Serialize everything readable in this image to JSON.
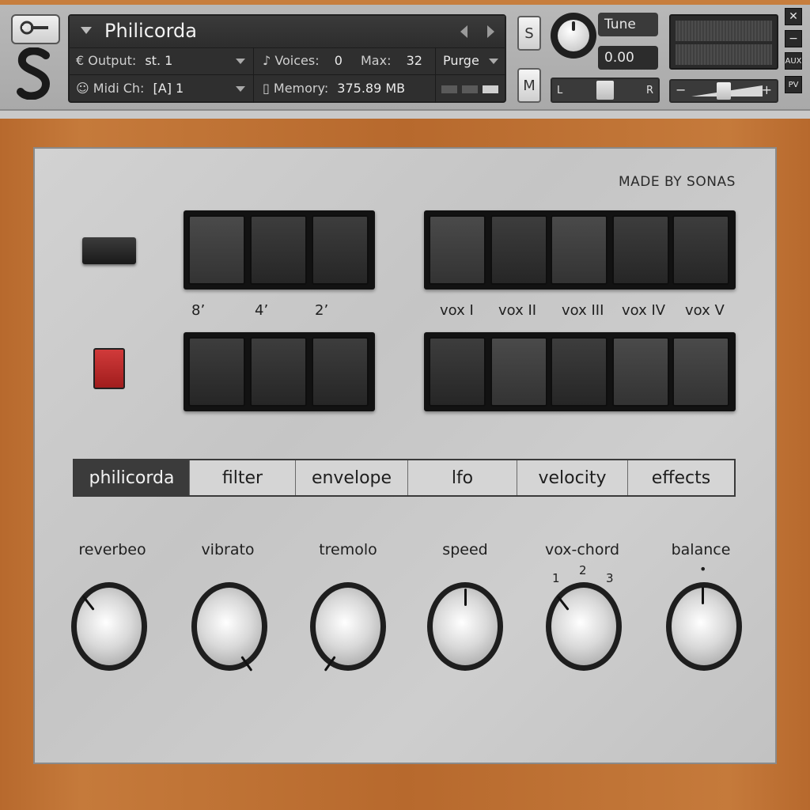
{
  "header": {
    "instrument_name": "Philicorda",
    "output_label": "Output:",
    "output_value": "st. 1",
    "voices_label": "Voices:",
    "voices_value": "0",
    "max_label": "Max:",
    "max_value": "32",
    "purge_label": "Purge",
    "midi_label": "Midi Ch:",
    "midi_value": "[A] 1",
    "memory_label": "Memory:",
    "memory_value": "375.89 MB",
    "solo_label": "S",
    "mute_label": "M",
    "tune_label": "Tune",
    "tune_value": "0.00",
    "pan_left": "L",
    "pan_right": "R",
    "vol_minus": "−",
    "vol_plus": "+",
    "close_label": "✕",
    "minimize_label": "−",
    "aux_label": "AUX",
    "pv_label": "PV"
  },
  "panel": {
    "brand": "MADE BY SONAS",
    "footage_labels": [
      "8’",
      "4’",
      "2’"
    ],
    "vox_labels": [
      "vox I",
      "vox II",
      "vox III",
      "vox IV",
      "vox V"
    ]
  },
  "tabs": [
    {
      "label": "philicorda",
      "active": true
    },
    {
      "label": "filter",
      "active": false
    },
    {
      "label": "envelope",
      "active": false
    },
    {
      "label": "lfo",
      "active": false
    },
    {
      "label": "velocity",
      "active": false
    },
    {
      "label": "effects",
      "active": false
    }
  ],
  "knobs": [
    {
      "label": "reverbeo"
    },
    {
      "label": "vibrato"
    },
    {
      "label": "tremolo"
    },
    {
      "label": "speed"
    },
    {
      "label": "vox-chord",
      "positions": [
        "1",
        "2",
        "3"
      ]
    },
    {
      "label": "balance",
      "center_mark": "•"
    }
  ],
  "icons": {
    "wrench": "wrench-icon",
    "logo": "s-logo-icon",
    "output": "output-icon",
    "voices": "voices-icon",
    "midi": "midi-icon",
    "memory": "memory-icon"
  }
}
